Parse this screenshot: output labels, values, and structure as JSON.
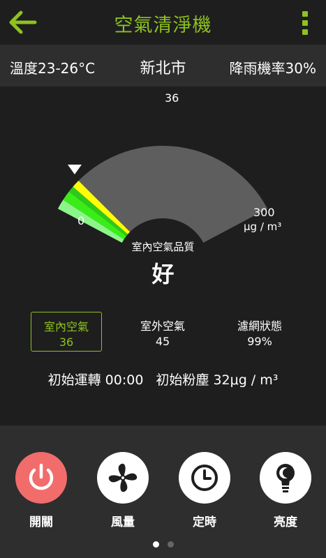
{
  "header": {
    "title": "空氣清淨機"
  },
  "info": {
    "temperature": "溫度23-26°C",
    "city": "新北市",
    "rain": "降雨機率30%"
  },
  "gauge": {
    "current_value": "36",
    "min_label": "0",
    "max_label": "300",
    "unit_label": "μg / m³",
    "current_fraction": 0.12,
    "colors": {
      "band1": "#8cf58a",
      "band2": "#3aed18",
      "band3": "#2ec91a",
      "indicator": "#ffff00",
      "rest": "#5e5e5e"
    }
  },
  "quality": {
    "label": "室內空氣品質",
    "value": "好"
  },
  "stats": [
    {
      "name": "室內空氣",
      "value": "36"
    },
    {
      "name": "室外空氣",
      "value": "45"
    },
    {
      "name": "濾網狀態",
      "value": "99%"
    }
  ],
  "details": {
    "start_time": "初始運轉 00:00",
    "initial_dust": "初始粉塵 32μg / m³"
  },
  "controls": [
    {
      "label": "開關",
      "icon": "power-icon"
    },
    {
      "label": "風量",
      "icon": "fan-icon"
    },
    {
      "label": "定時",
      "icon": "clock-icon"
    },
    {
      "label": "亮度",
      "icon": "lightbulb-icon"
    }
  ],
  "pagination": {
    "active_index": 0,
    "count": 2
  },
  "colors": {
    "accent": "#8dc21f",
    "power": "#f26c6c",
    "panel": "#2e2e2e",
    "background": "#1e1e1e"
  }
}
